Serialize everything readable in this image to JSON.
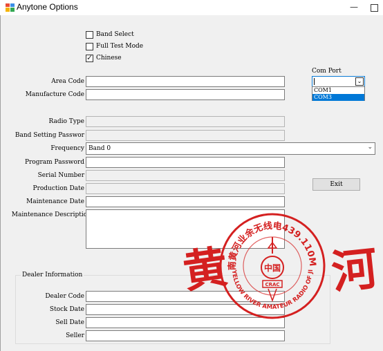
{
  "window": {
    "title": "Anytone Options",
    "minimize_glyph": "—"
  },
  "options": {
    "band_select": {
      "label": "Band Select",
      "checked": false
    },
    "full_test_mode": {
      "label": "Full Test Mode",
      "checked": false
    },
    "chinese": {
      "label": "Chinese",
      "checked": true,
      "check_glyph": "✓"
    }
  },
  "com_port": {
    "label": "Com Port",
    "value": "",
    "arrow_glyph": "⌄",
    "options": [
      {
        "label": "COM1",
        "highlighted": false
      },
      {
        "label": "COM3",
        "highlighted": true
      }
    ]
  },
  "fields": {
    "area_code": {
      "label": "Area Code",
      "value": ""
    },
    "manufacture_code": {
      "label": "Manufacture Code",
      "value": ""
    },
    "radio_type": {
      "label": "Radio Type",
      "value": ""
    },
    "band_setting_password": {
      "label": "Band Setting Passwor",
      "value": ""
    },
    "frequency": {
      "label": "Frequency",
      "value": "Band 0",
      "arrow_glyph": "⌄"
    },
    "program_password": {
      "label": "Program Password",
      "value": ""
    },
    "serial_number": {
      "label": "Serial Number",
      "value": ""
    },
    "production_date": {
      "label": "Production Date",
      "value": ""
    },
    "maintenance_date": {
      "label": "Maintenance Date",
      "value": ""
    },
    "maintenance_description": {
      "label": "Maintenance Description",
      "value": ""
    }
  },
  "exit_button": {
    "label": "Exit"
  },
  "dealer": {
    "group_title": "Dealer Information",
    "dealer_code": {
      "label": "Dealer Code",
      "value": ""
    },
    "stock_date": {
      "label": "Stock Date",
      "value": ""
    },
    "sell_date": {
      "label": "Sell Date",
      "value": ""
    },
    "seller": {
      "label": "Seller",
      "value": ""
    }
  },
  "watermark": {
    "stamp_color": "#d42020",
    "stamp_top_text": "济南黄河业余无线电439.110MHz",
    "stamp_bottom_text": "THE YELLOW RIVER AMATEUR RADIO OF JINAN",
    "stamp_center_text": "中国",
    "stamp_badge_text": "CRAC",
    "calligraphy_left": "黄",
    "calligraphy_right": "河"
  },
  "colors": {
    "window_bg": "#f0f0f0",
    "accent": "#0078d7",
    "stamp": "#d42020"
  }
}
